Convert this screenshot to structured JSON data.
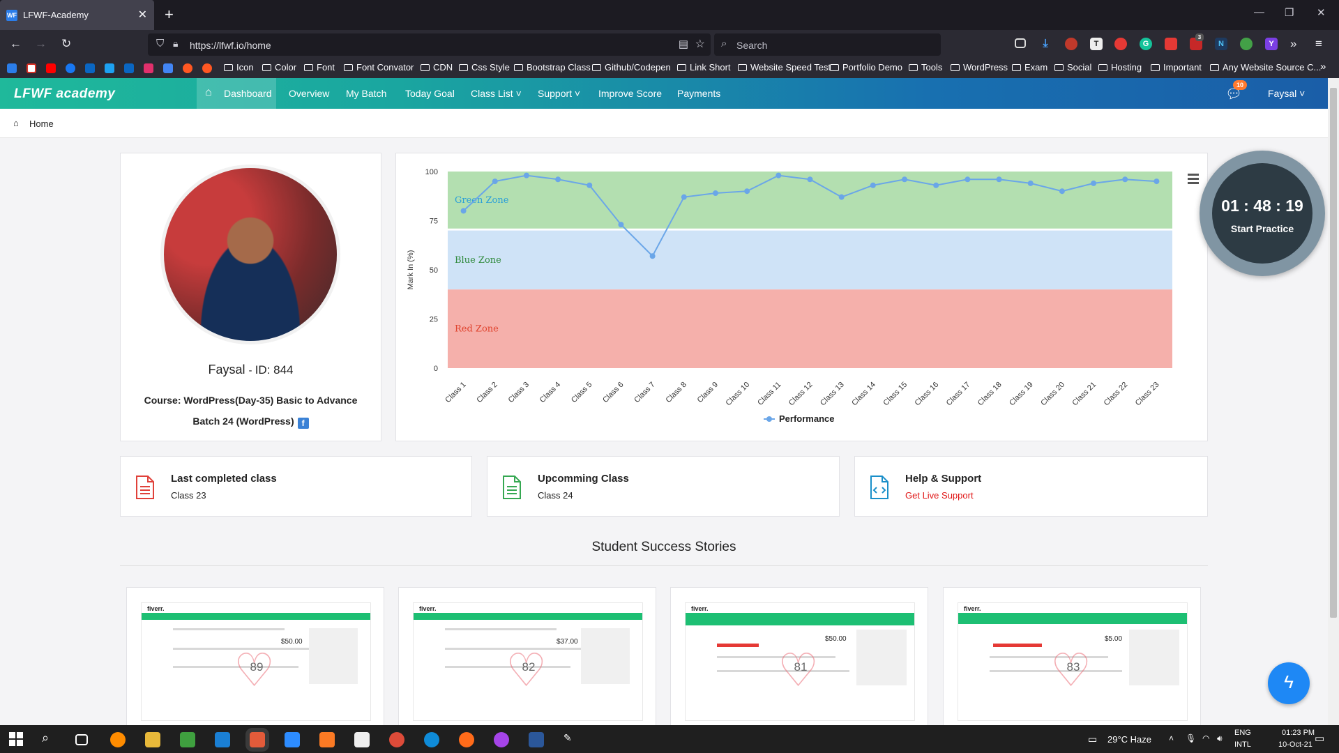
{
  "browser": {
    "tab_title": "LFWF-Academy",
    "tab_favicon": "WF",
    "url": "https://lfwf.io/home",
    "search_placeholder": "Search",
    "extension_badge": "3"
  },
  "bookmarks": [
    "Icon",
    "Color",
    "Font",
    "Font Convator",
    "CDN",
    "Css Style",
    "Bootstrap Class",
    "Github/Codepen",
    "Link Short",
    "Website Speed Test",
    "Portfolio Demo",
    "Tools",
    "WordPress",
    "Exam",
    "Social",
    "Hosting",
    "Important",
    "Any Website Source C..."
  ],
  "app": {
    "logo": "LFWF academy",
    "menu": {
      "dashboard": "Dashboard",
      "overview": "Overview",
      "my_batch": "My Batch",
      "today_goal": "Today Goal",
      "class_list": "Class List",
      "support": "Support",
      "improve_score": "Improve Score",
      "payments": "Payments"
    },
    "notifications": "10",
    "user": "Faysal"
  },
  "breadcrumb": "Home",
  "profile": {
    "name": "Faysal",
    "id": "ID: 844",
    "course": "Course: WordPress(Day-35) Basic to Advance",
    "batch": "Batch 24 (WordPress)"
  },
  "chart_data": {
    "type": "line",
    "title": "",
    "xlabel": "",
    "ylabel": "Mark In (%)",
    "ylim": [
      0,
      100
    ],
    "yticks": [
      0,
      25,
      50,
      75,
      100
    ],
    "grid": false,
    "legend": "bottom",
    "categories": [
      "Class 1",
      "Class 2",
      "Class 3",
      "Class 4",
      "Class 5",
      "Class 6",
      "Class 7",
      "Class 8",
      "Class 9",
      "Class 10",
      "Class 11",
      "Class 12",
      "Class 13",
      "Class 14",
      "Class 15",
      "Class 16",
      "Class 17",
      "Class 18",
      "Class 19",
      "Class 20",
      "Class 21",
      "Class 22",
      "Class 23"
    ],
    "series": [
      {
        "name": "Performance",
        "color": "#6aa6e8",
        "values": [
          80,
          95,
          98,
          96,
          93,
          73,
          57,
          87,
          89,
          90,
          98,
          96,
          87,
          93,
          96,
          93,
          96,
          96,
          94,
          90,
          94,
          96,
          95
        ]
      }
    ],
    "bands": [
      {
        "label": "Green Zone",
        "from": 71,
        "to": 100,
        "color": "#b3dfb0",
        "text_color": "#2a9fd8"
      },
      {
        "label": "Blue Zone",
        "from": 40,
        "to": 70,
        "color": "#cfe3f7",
        "text_color": "#2f8a3c"
      },
      {
        "label": "Red Zone",
        "from": 0,
        "to": 40,
        "color": "#f5b0ab",
        "text_color": "#e0432e"
      }
    ]
  },
  "timer": {
    "time": "01 : 48 : 19",
    "label": "Start Practice"
  },
  "info_cards": [
    {
      "title": "Last completed class",
      "subtitle": "Class 23",
      "color": "#e0413a",
      "subtitle_color": "#222222"
    },
    {
      "title": "Upcomming Class",
      "subtitle": "Class 24",
      "color": "#36a852",
      "subtitle_color": "#222222"
    },
    {
      "title": "Help & Support",
      "subtitle": "Get Live Support",
      "color": "#1a8fc9",
      "subtitle_color": "#e01515"
    }
  ],
  "stories": {
    "title": "Student Success Stories",
    "items": [
      {
        "score": "89",
        "price": "$50.00",
        "brand": "fiverr."
      },
      {
        "score": "82",
        "price": "$37.00",
        "brand": "fiverr."
      },
      {
        "score": "81",
        "price": "$50.00",
        "brand": "fiverr."
      },
      {
        "score": "83",
        "price": "$5.00",
        "brand": "fiverr."
      }
    ]
  },
  "taskbar": {
    "weather": "29°C  Haze",
    "lang": "ENG",
    "layout": "INTL",
    "time": "01:23 PM",
    "date": "10-Oct-21"
  }
}
